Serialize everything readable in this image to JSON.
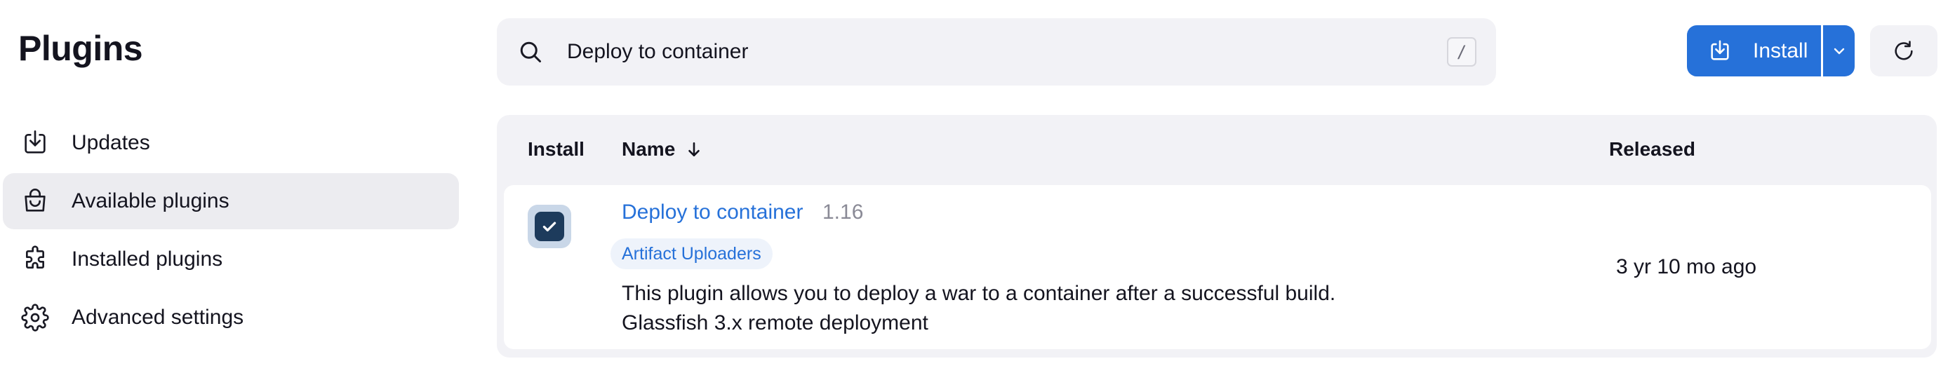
{
  "page": {
    "title": "Plugins"
  },
  "sidebar": {
    "items": [
      {
        "label": "Updates",
        "icon": "download-icon",
        "active": false
      },
      {
        "label": "Available plugins",
        "icon": "shopping-bag-icon",
        "active": true
      },
      {
        "label": "Installed plugins",
        "icon": "puzzle-icon",
        "active": false
      },
      {
        "label": "Advanced settings",
        "icon": "gear-icon",
        "active": false
      }
    ]
  },
  "search": {
    "value": "Deploy to container",
    "shortcut": "/",
    "icon": "search-icon"
  },
  "toolbar": {
    "install_label": "Install",
    "install_icon": "download-icon",
    "dropdown_icon": "chevron-down-icon",
    "refresh_icon": "refresh-icon"
  },
  "table": {
    "headers": {
      "install": "Install",
      "name": "Name",
      "released": "Released"
    },
    "sort_icon": "arrow-down-icon",
    "rows": [
      {
        "checked": true,
        "name": "Deploy to container",
        "version": "1.16",
        "category": "Artifact Uploaders",
        "description_line1": "This plugin allows you to deploy a war to a container after a successful build.",
        "description_line2": "Glassfish 3.x remote deployment",
        "released": "3 yr 10 mo ago"
      }
    ]
  },
  "colors": {
    "accent": "#2671d9",
    "panel_bg": "#f2f2f6",
    "active_item_bg": "#ececf0",
    "checkbox_bg": "#1d3b5c"
  }
}
